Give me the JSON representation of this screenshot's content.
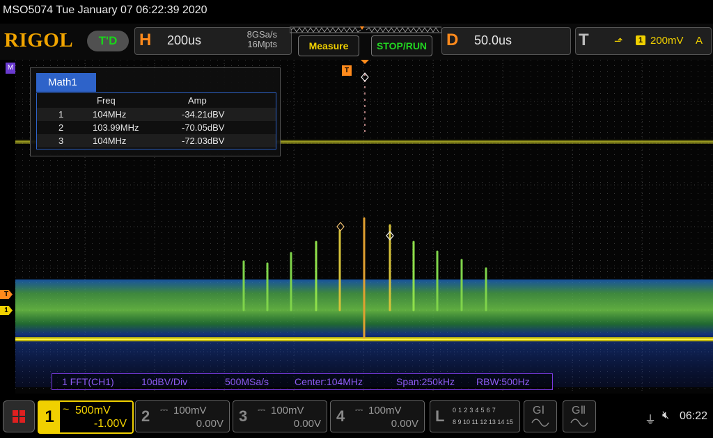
{
  "status_line": "MSO5074  Tue January 07 06:22:39 2020",
  "header": {
    "logo": "RIGOL",
    "mode_badge": "T'D",
    "horizontal": {
      "letter": "H",
      "timebase": "200us",
      "sample_rate": "8GSa/s",
      "memory_depth": "16Mpts"
    },
    "measure_label": "Measure",
    "stop_run_label": "STOP/RUN",
    "delay": {
      "letter": "D",
      "value": "50.0us"
    },
    "trigger": {
      "letter": "T",
      "source": "1",
      "level": "200mV",
      "mode": "A"
    }
  },
  "markers": {
    "math": "M",
    "trigger_level": "T",
    "ch1": "1",
    "trigger_position": "T"
  },
  "math_window": {
    "tab_label": "Math1",
    "columns": [
      "Freq",
      "Amp"
    ],
    "rows": [
      {
        "index": "1",
        "freq": "104MHz",
        "amp": "-34.21dBV"
      },
      {
        "index": "2",
        "freq": "103.99MHz",
        "amp": "-70.05dBV"
      },
      {
        "index": "3",
        "freq": "104MHz",
        "amp": "-72.03dBV"
      }
    ]
  },
  "fft_info": {
    "source": "1 FFT(CH1)",
    "scale": "10dBV/Div",
    "rate": "500MSa/s",
    "center": "Center:104MHz",
    "span": "Span:250kHz",
    "rbw": "RBW:500Hz"
  },
  "channels": [
    {
      "num": "1",
      "coupling": "~",
      "scale": "500mV",
      "offset": "-1.00V",
      "color": "#f0d000",
      "active": true
    },
    {
      "num": "2",
      "coupling": "⎓",
      "scale": "100mV",
      "offset": "0.00V",
      "active": false
    },
    {
      "num": "3",
      "coupling": "⎓",
      "scale": "100mV",
      "offset": "0.00V",
      "active": false
    },
    {
      "num": "4",
      "coupling": "⎓",
      "scale": "100mV",
      "offset": "0.00V",
      "active": false
    }
  ],
  "logic": {
    "letter": "L",
    "row1": "0 1 2 3  4 5 6 7",
    "row2": "8 9 10 11 12 13 14 15"
  },
  "generators": [
    {
      "label": "GⅠ"
    },
    {
      "label": "GⅡ"
    }
  ],
  "system": {
    "clock": "06:22",
    "usb_icon": "usb-icon",
    "sound_icon": "speaker-muted-icon"
  },
  "colors": {
    "accent_orange": "#ff8a1c",
    "ch1_yellow": "#f0d000",
    "math_purple": "#7a3ae0",
    "table_blue": "#2e63c9"
  }
}
